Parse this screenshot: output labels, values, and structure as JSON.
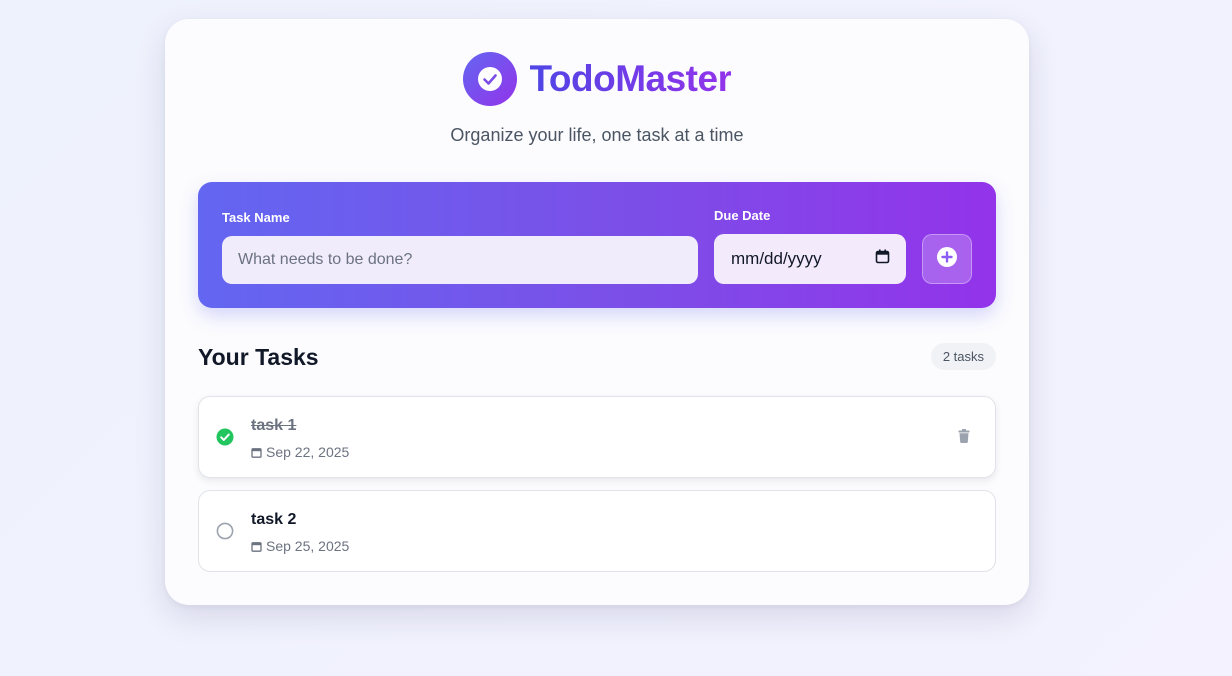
{
  "app": {
    "title": "TodoMaster",
    "subtitle": "Organize your life, one task at a time"
  },
  "form": {
    "task_label": "Task Name",
    "task_placeholder": "What needs to be done?",
    "date_label": "Due Date",
    "date_placeholder": "mm/dd/yyyy",
    "add_icon": "plus-circle-icon"
  },
  "tasks_section": {
    "heading": "Your Tasks",
    "count_label": "2 tasks"
  },
  "tasks": [
    {
      "name": "task 1",
      "date": "Sep 22, 2025",
      "completed": true
    },
    {
      "name": "task 2",
      "date": "Sep 25, 2025",
      "completed": false
    }
  ],
  "colors": {
    "accent_start": "#6366f1",
    "accent_end": "#9333ea",
    "done_green": "#22c55e"
  }
}
